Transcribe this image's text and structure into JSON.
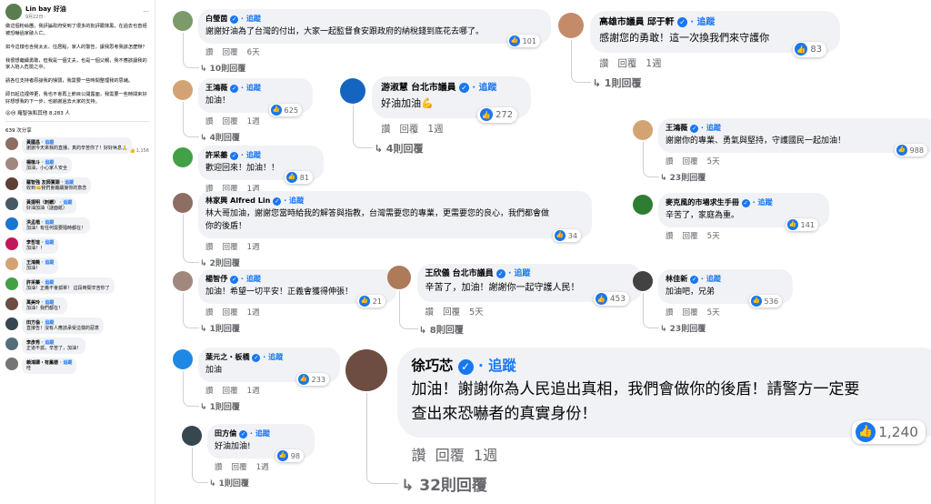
{
  "post": {
    "author": "Lin bay 好油",
    "date": "9月22日 · ",
    "more": "···",
    "text": "做這個粉絲團，我評論政府受到了很多的批評跟抹黑，在過去也曾經被恐嚇過家破人亡。\n\n如今這樣也含我太太、住居點，家人的警告，讓我思考我該怎麼辦？\n\n我很想繼續勇敢，但我是一個丈夫，也是一個父親，我不應該讓我的家人陷入危險之中。\n\n請各位支持者原諒我的懦弱，我需要一些時間整理我的思緒。\n\n即日起這裡停更，我也不會再上節目公開露面，我需要一些時間來好好想想我的下一步，也謝謝過去大家的支持。",
    "reactions": "😮😢 羅智強和其他 8,283 人",
    "comment_count": "639 次分享"
  },
  "mini_comments": [
    {
      "name": "黃國昌",
      "follow": "· 追蹤",
      "text": "謝謝今天來我的直播，真的辛苦你了！好好休息🙏",
      "likes": "1,156",
      "color": "#8d6e63"
    },
    {
      "name": "楊植斗",
      "follow": "· 追蹤",
      "text": "加油，小心家人安全",
      "likes": "",
      "color": "#a1887f"
    },
    {
      "name": "羅智強 友師賈跟",
      "follow": "· 追蹤",
      "text": "收到👊我們會繼續接你的意念",
      "likes": "",
      "color": "#5d4037"
    },
    {
      "name": "黃揚明（刺蝟）",
      "follow": "· 追蹤",
      "text": "好油加油（謎面紙）",
      "likes": "",
      "color": "#455a64"
    },
    {
      "name": "洪孟楷",
      "follow": "· 追蹤",
      "text": "加油！有任何需要隨時都在！",
      "likes": "",
      "color": "#1976d2"
    },
    {
      "name": "李哲瑄",
      "follow": "· 追蹤",
      "text": "加油！！",
      "likes": "",
      "color": "#c2185b"
    },
    {
      "name": "王鴻薇",
      "follow": "· 追蹤",
      "text": "加油！",
      "likes": "",
      "color": "#d4a373"
    },
    {
      "name": "許采蓁",
      "follow": "· 追蹤",
      "text": "加油！正義不會孤單！\n這段時間辛苦你了",
      "likes": "",
      "color": "#43a047"
    },
    {
      "name": "萬美玲",
      "follow": "· 追蹤",
      "text": "加油！我們都在！",
      "likes": "",
      "color": "#6d4c41"
    },
    {
      "name": "田方倫",
      "follow": "· 追蹤",
      "text": "直接告！沒有人應該承受這樣的惡意",
      "likes": "",
      "color": "#37474f"
    },
    {
      "name": "李彥秀",
      "follow": "· 追蹤",
      "text": "正道不孤，辛苦了，加油！",
      "likes": "",
      "color": "#546e7a"
    },
    {
      "name": "賴鴻聰・有鳳德",
      "follow": "· 追蹤",
      "text": "哇",
      "likes": "",
      "color": "#757575"
    }
  ],
  "cards": [
    {
      "name": "白瑩茵",
      "follow": "· 追蹤",
      "text": "謝謝好油為了台灣的付出，大家一起監督食安跟政府的納稅錢到底花去哪了。",
      "likes": "101",
      "time": "6天",
      "act1": "讚",
      "act2": "回覆",
      "replies": "10則回覆",
      "color": "#7b9b6b"
    },
    {
      "name": "高雄市議員 邱于軒",
      "follow": "· 追蹤",
      "text": "感謝您的勇敢！這一次換我們來守護你",
      "likes": "83",
      "time": "1週",
      "act1": "讚",
      "act2": "回覆",
      "replies": "1則回覆",
      "color": "#c48b6a"
    },
    {
      "name": "王鴻薇",
      "follow": "· 追蹤",
      "text": "加油！",
      "likes": "625",
      "time": "1週",
      "act1": "讚",
      "act2": "回覆",
      "replies": "4則回覆",
      "color": "#d4a373"
    },
    {
      "name": "游淑慧 台北市議員",
      "follow": "· 追蹤",
      "text": "好油加油💪",
      "likes": "272",
      "time": "1週",
      "act1": "讚",
      "act2": "回覆",
      "replies": "4則回覆",
      "color": "#1565c0"
    },
    {
      "name": "王鴻薇",
      "follow": "· 追蹤",
      "text": "謝謝你的專業、勇氣與堅持，守護國民一起加油！",
      "likes": "988",
      "time": "5天",
      "act1": "讚",
      "act2": "回覆",
      "replies": "23則回覆",
      "color": "#d4a373"
    },
    {
      "name": "許采蓁",
      "follow": "· 追蹤",
      "text": "歡迎回來！加油！！",
      "likes": "81",
      "time": "1週",
      "act1": "讚",
      "act2": "回覆",
      "replies": "",
      "color": "#43a047"
    },
    {
      "name": "林家興 Alfred Lin",
      "follow": "· 追蹤",
      "text": "林大哥加油，謝謝您當時給我的解答與指教，台灣需要您的專業，更需要您的良心，我們都會做你的後盾！",
      "likes": "34",
      "time": "1週",
      "act1": "讚",
      "act2": "回覆",
      "replies": "2則回覆",
      "color": "#8d6e63"
    },
    {
      "name": "麥克風的市場求生手冊",
      "follow": "· 追蹤",
      "text": "辛苦了，家庭為重。",
      "likes": "141",
      "time": "5天",
      "act1": "讚",
      "act2": "回覆",
      "replies": "",
      "color": "#2e7d32"
    },
    {
      "name": "楊智伃",
      "follow": "· 追蹤",
      "text": "加油！希望一切平安！正義會獲得伸張！",
      "likes": "21",
      "time": "1週",
      "act1": "讚",
      "act2": "回覆",
      "replies": "1則回覆",
      "color": "#a1887f"
    },
    {
      "name": "王欣儀 台北市議員",
      "follow": "· 追蹤",
      "text": "辛苦了，加油！謝謝你一起守護人民！",
      "likes": "453",
      "time": "5天",
      "act1": "讚",
      "act2": "回覆",
      "replies": "8則回覆",
      "color": "#ad7a5a"
    },
    {
      "name": "林佳新",
      "follow": "· 追蹤",
      "text": "加油吧，兄弟",
      "likes": "536",
      "time": "5天",
      "act1": "讚",
      "act2": "回覆",
      "replies": "23則回覆",
      "color": "#424242"
    },
    {
      "name": "葉元之・板橋",
      "follow": "· 追蹤",
      "text": "加油",
      "likes": "233",
      "time": "1週",
      "act1": "讚",
      "act2": "回覆",
      "replies": "1則回覆",
      "color": "#1e88e5"
    },
    {
      "name": "田方倫",
      "follow": "· 追蹤",
      "text": "好油加油!",
      "likes": "98",
      "time": "1週",
      "act1": "讚",
      "act2": "回覆",
      "replies": "1則回覆",
      "color": "#37474f"
    },
    {
      "name": "徐巧芯",
      "follow": "· 追蹤",
      "text": "加油！謝謝你為人民追出真相，我們會做你的後盾！請警方一定要查出來恐嚇者的真實身份！",
      "likes": "1,240",
      "time": "1週",
      "act1": "讚",
      "act2": "回覆",
      "replies": "32則回覆",
      "color": "#6d4c41"
    }
  ],
  "icons": {
    "like": "👍",
    "reply_arrow": "↳",
    "verified": "✓"
  }
}
